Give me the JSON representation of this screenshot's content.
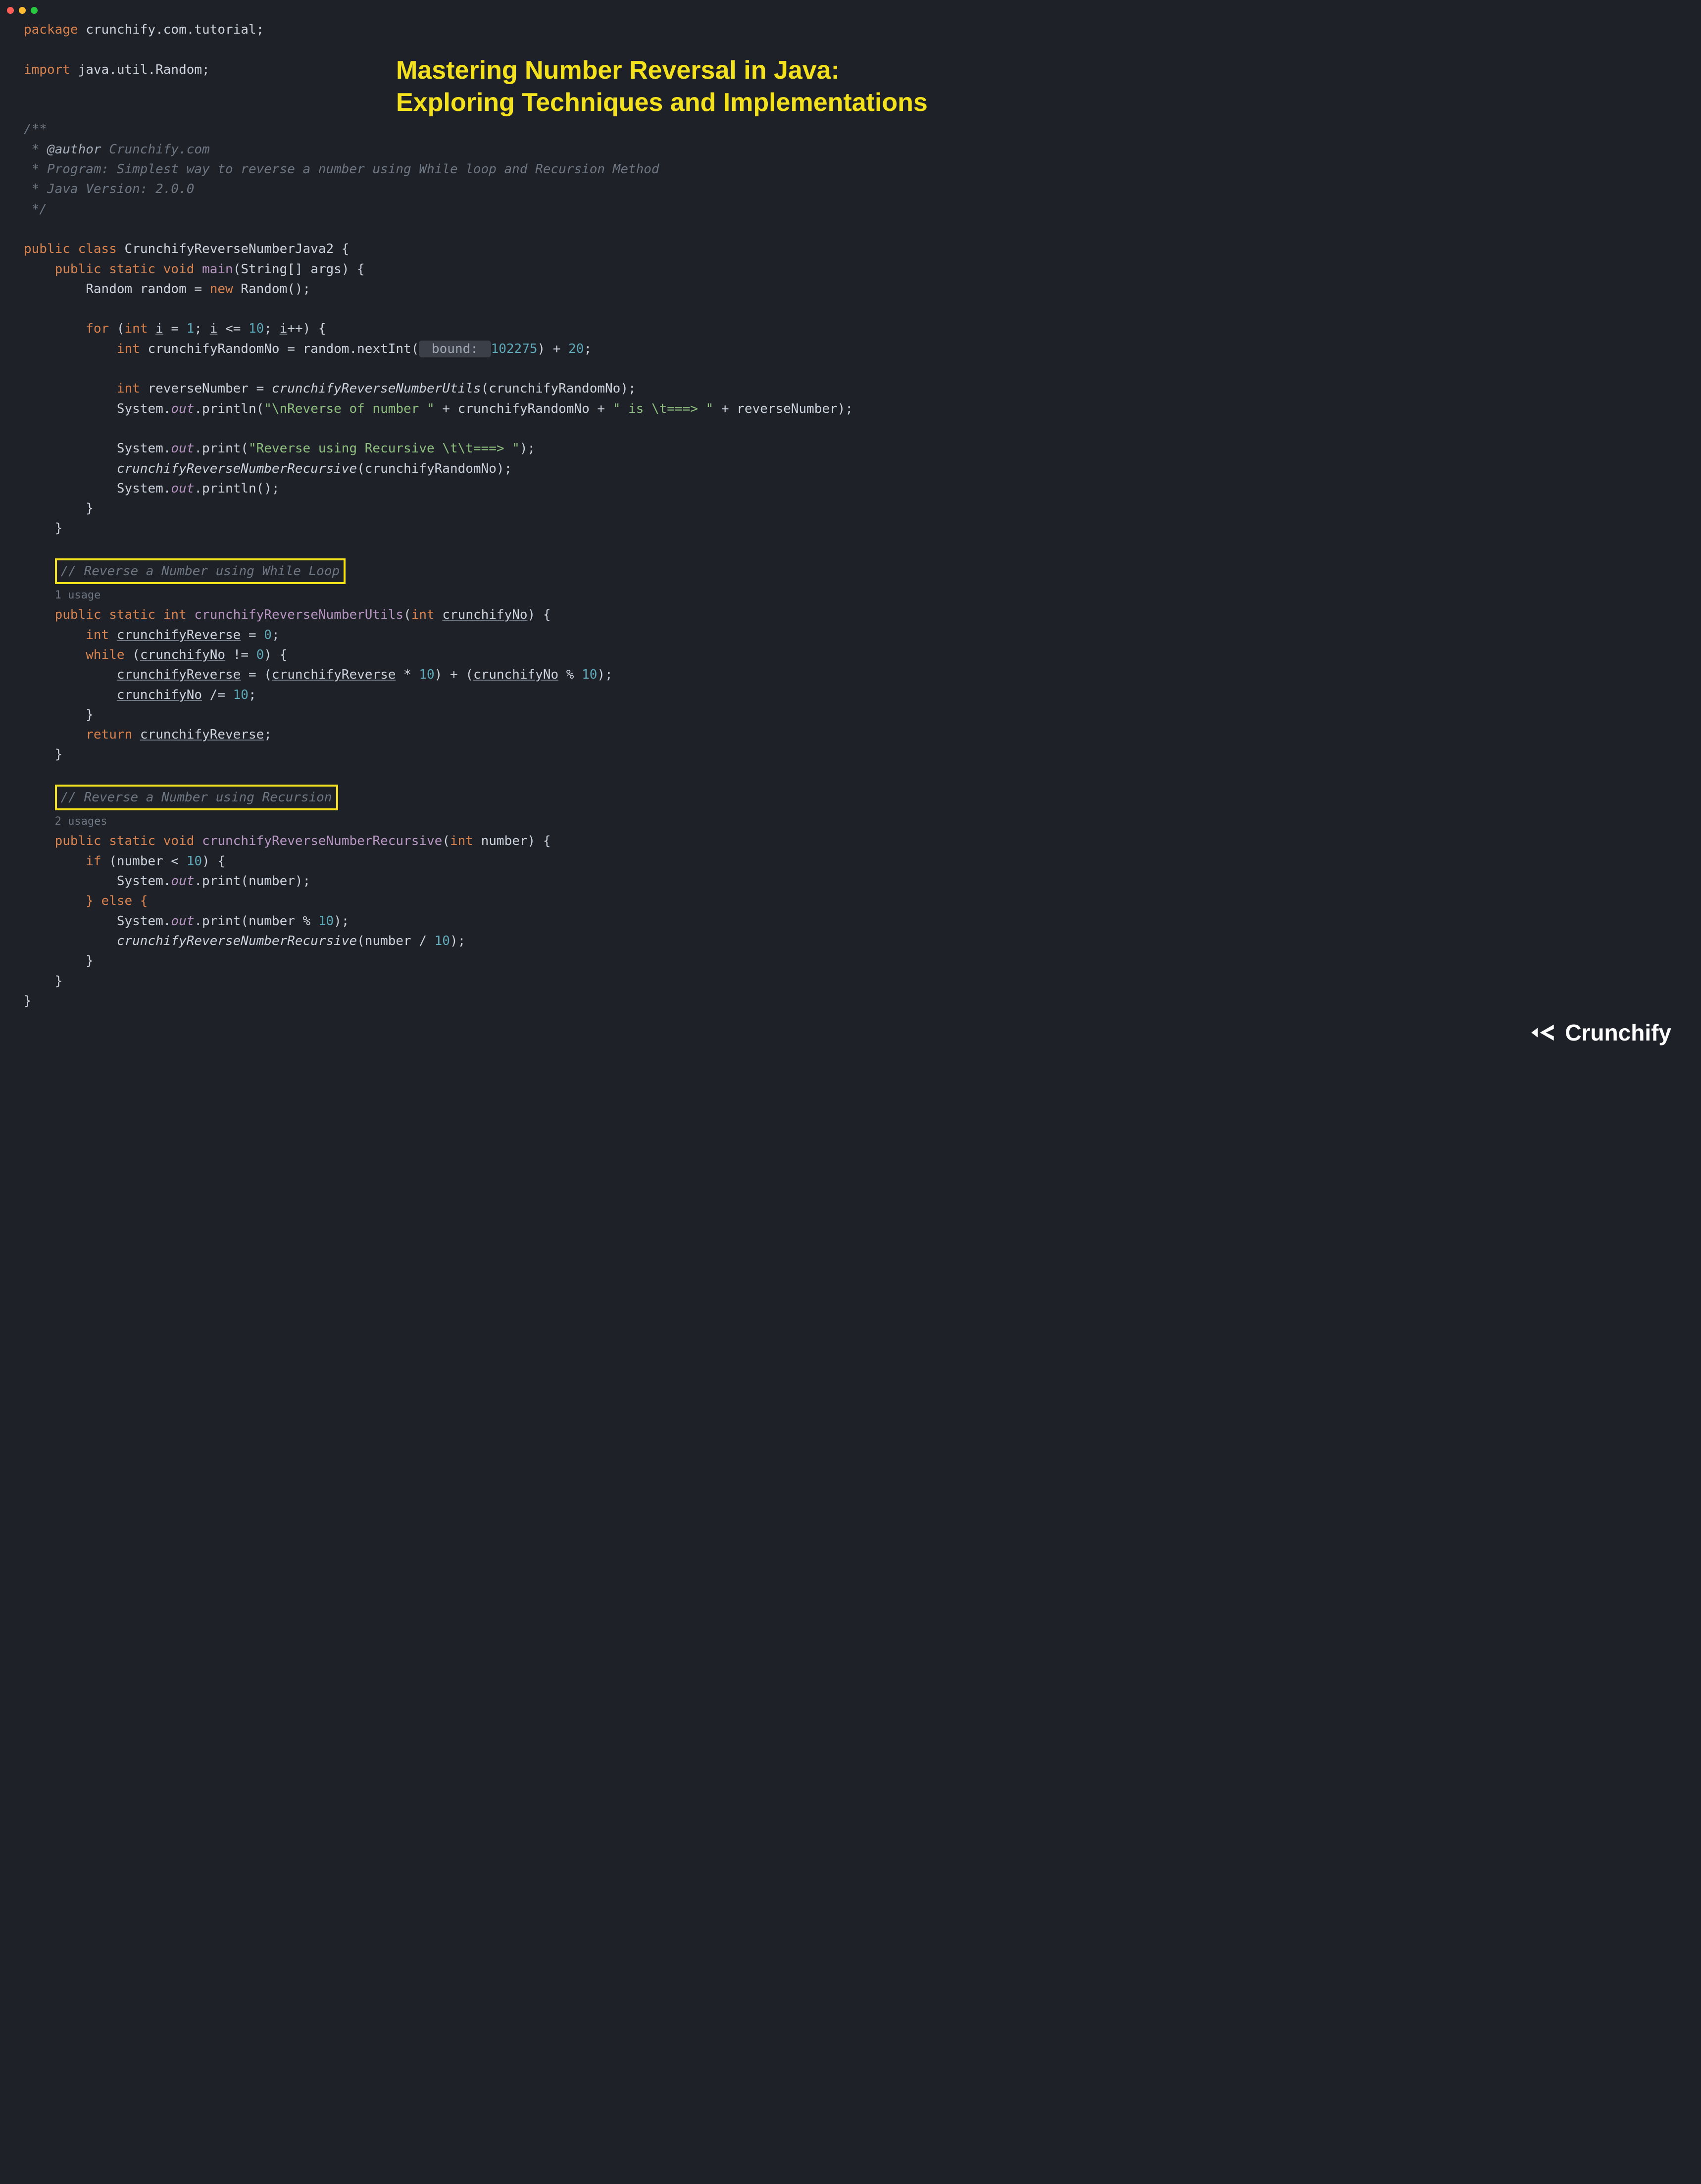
{
  "title_line1": "Mastering Number Reversal in Java:",
  "title_line2": "Exploring Techniques and Implementations",
  "logo_text": "Crunchify",
  "code": {
    "package": "package",
    "pkg_name": "crunchify.com.tutorial;",
    "import": "import",
    "import_name": "java.util.Random;",
    "doc_start": "/**",
    "doc_author_tag": "@author",
    "doc_author_val": "Crunchify.com",
    "doc_line2": "Program: Simplest way to reverse a number using While loop and Recursion Method",
    "doc_line3": "Java Version: 2.0.0",
    "doc_end": "*/",
    "public": "public",
    "class": "class",
    "class_name": "CrunchifyReverseNumberJava2",
    "static": "static",
    "void": "void",
    "main": "main",
    "main_params": "(String[] args) {",
    "random_decl": "Random random = ",
    "new": "new",
    "random_ctor": " Random();",
    "for": "for",
    "int": "int",
    "for_sig_1": " (",
    "for_var": "i",
    "for_eq": " = ",
    "for_init": "1",
    "for_sep": "; ",
    "for_cond_var": "i",
    "for_cond_op": " <= ",
    "for_cond_val": "10",
    "for_inc_var": "i",
    "for_inc": "++) {",
    "rand_var": " crunchifyRandomNo = random.nextInt(",
    "hint_label": " bound: ",
    "hint_val": "102275",
    "rand_tail_1": ") + ",
    "rand_tail_num": "20",
    "rand_tail_2": ";",
    "rev_decl": " reverseNumber = ",
    "rev_call": "crunchifyReverseNumberUtils",
    "rev_args": "(crunchifyRandomNo);",
    "sys": "System.",
    "out": "out",
    "println": ".println(",
    "print": ".print(",
    "str1": "\"\\nReverse of number \"",
    "plus": " + ",
    "var_rand": "crunchifyRandomNo",
    "str2": "\" is \\t===> \"",
    "var_rev": "reverseNumber",
    "stmt_end": ");",
    "str3": "\"Reverse using Recursive \\t\\t===> \"",
    "rec_call": "crunchifyReverseNumberRecursive",
    "rec_args": "(crunchifyRandomNo);",
    "println_empty": ".println();",
    "brace_close": "}",
    "cmt_while": "// Reverse a Number using While Loop",
    "usage1": "1 usage",
    "utils_name": "crunchifyReverseNumberUtils",
    "utils_params": "(",
    "utils_param_var": "crunchifyNo",
    "utils_params_end": ") {",
    "rev_var_decl": "crunchifyReverse",
    "eq0": " = ",
    "zero": "0",
    "semi": ";",
    "while": "while",
    "while_open": " (",
    "while_var": "crunchifyNo",
    "while_op": " != ",
    "while_val": "0",
    "while_close": ") {",
    "assign_var_l": "crunchifyReverse",
    "assign_eq": " = (",
    "assign_var_l2": "crunchifyReverse",
    "mul": " * ",
    "ten": "10",
    "assign_mid": ") + (",
    "assign_var_r": "crunchifyNo",
    "mod": " % ",
    "assign_end": ");",
    "diveq_var": "crunchifyNo",
    "diveq": " /= ",
    "return": "return",
    "ret_var": "crunchifyReverse",
    "cmt_rec": "// Reverse a Number using Recursion",
    "usage2": "2 usages",
    "rec_name": "crunchifyReverseNumberRecursive",
    "rec_params": "(",
    "rec_param_var": "number",
    "rec_params_end": ") {",
    "if": "if",
    "if_open": " (number < ",
    "if_val": "10",
    "if_close": ") {",
    "print_num": ".print(number);",
    "else": "} else {",
    "print_mod1": ".print(number % ",
    "print_mod_end": ");",
    "rec_self": "crunchifyReverseNumberRecursive",
    "rec_self_args1": "(number / ",
    "rec_self_args2": ");"
  }
}
